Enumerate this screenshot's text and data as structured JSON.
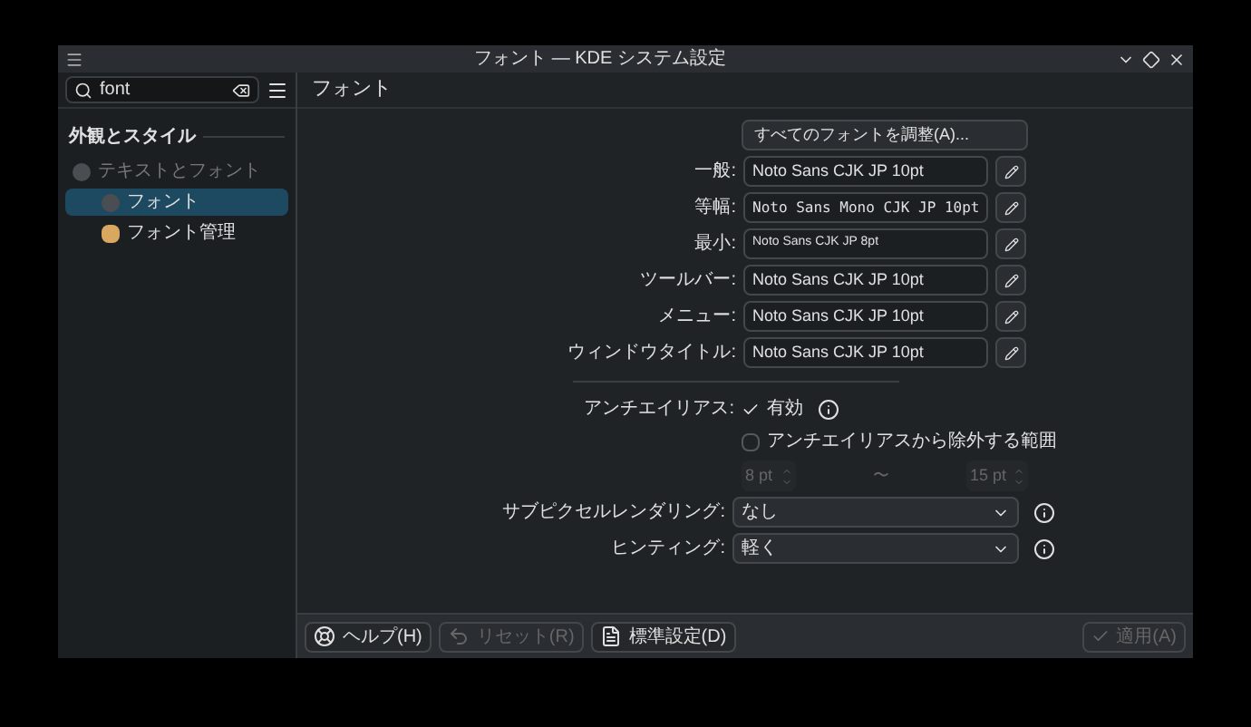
{
  "window": {
    "title": "フォント — KDE システム設定"
  },
  "search": {
    "value": "font"
  },
  "sidebar": {
    "category": "外観とスタイル",
    "items": [
      {
        "label": "テキストとフォント",
        "kind": "parent",
        "selected": false
      },
      {
        "label": "フォント",
        "kind": "child",
        "selected": true
      },
      {
        "label": "フォント管理",
        "kind": "child-app",
        "selected": false
      }
    ]
  },
  "page": {
    "title": "フォント"
  },
  "adjust_button": {
    "label": "すべてのフォントを調整(A)..."
  },
  "font_rows": [
    {
      "label": "一般:",
      "value": "Noto Sans CJK JP 10pt",
      "kind": "normal"
    },
    {
      "label": "等幅:",
      "value": "Noto Sans Mono CJK JP 10pt",
      "kind": "mono"
    },
    {
      "label": "最小:",
      "value": "Noto Sans CJK JP 8pt",
      "kind": "small"
    },
    {
      "label": "ツールバー:",
      "value": "Noto Sans CJK JP 10pt",
      "kind": "normal"
    },
    {
      "label": "メニュー:",
      "value": "Noto Sans CJK JP 10pt",
      "kind": "normal"
    },
    {
      "label": "ウィンドウタイトル:",
      "value": "Noto Sans CJK JP 10pt",
      "kind": "normal"
    }
  ],
  "antialiasing": {
    "label": "アンチエイリアス:",
    "option": "有効",
    "checked": true
  },
  "exclude": {
    "label": "アンチエイリアスから除外する範囲",
    "checked": false,
    "from": "8 pt",
    "separator": "〜",
    "to": "15 pt"
  },
  "selects": [
    {
      "label": "サブピクセルレンダリング:",
      "value": "なし"
    },
    {
      "label": "ヒンティング:",
      "value": "軽く"
    }
  ],
  "footer_buttons": [
    {
      "label": "ヘルプ(H)",
      "kind": "help",
      "disabled": false
    },
    {
      "label": "リセット(R)",
      "kind": "reset",
      "disabled": true
    },
    {
      "label": "標準設定(D)",
      "kind": "defaults",
      "disabled": false
    }
  ],
  "apply_button": {
    "label": "適用(A)",
    "disabled": true
  }
}
